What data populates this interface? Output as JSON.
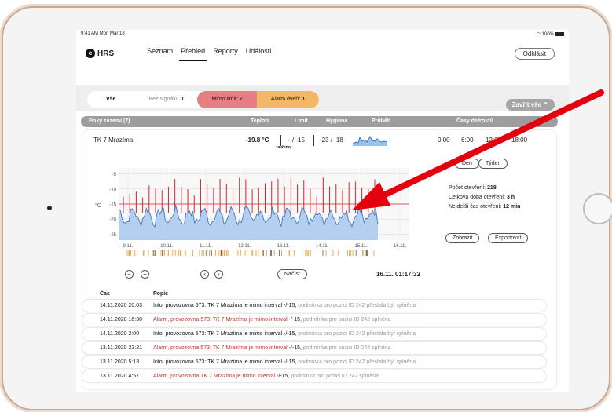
{
  "status": {
    "time": "9:41 AM  Mon Mar 18",
    "battery": "100%"
  },
  "nav": {
    "logo": "HRS",
    "links": [
      "Seznam",
      "Přehled",
      "Reporty",
      "Události"
    ],
    "logout": "Odhlásit"
  },
  "filters": {
    "all": "Vše",
    "nosignal": "Bez signálu: ",
    "nosignal_count": "0",
    "outlimit": "Mimo limit: ",
    "outlimit_count": "7",
    "door": "Alarm dveří: ",
    "door_count": "1",
    "collapse": "Zavřít vše"
  },
  "group": {
    "title": "Boxy zázemí (7)",
    "cols": [
      "Teplota",
      "Limit",
      "Hygiena",
      "Průběh",
      "Časy defrostů"
    ]
  },
  "card": {
    "name": "TK 7 Mrazíma",
    "temp": "-19.8 °C",
    "temp_sub": "zavřeno",
    "limit": "- / -15",
    "hygiene": "-23 / -18",
    "defrost_times": [
      "0:00",
      "6:00",
      "12:00",
      "18:00"
    ],
    "btn_day": "Den",
    "btn_week": "Týden",
    "stat1_label": "Počet otevření: ",
    "stat1_value": "218",
    "stat2_label": "Celková doba otevření: ",
    "stat2_value": "3 h",
    "stat3_label": "Nejdelší čas otevření: ",
    "stat3_value": "12 min",
    "btn_show": "Zobrazit",
    "btn_export": "Exportovat",
    "btn_load": "Načíst",
    "timestamp": "16.11. 01:17:32"
  },
  "chart_data": {
    "type": "line",
    "ylabel": "°C",
    "yticks": [
      "-5",
      "-10",
      "-15",
      "-20",
      "-25"
    ],
    "ylim": [
      -27,
      -3
    ],
    "x": [
      "9.11.",
      "10.11.",
      "11.11.",
      "12.11.",
      "13.11.",
      "14.11.",
      "15.11.",
      "16.11."
    ],
    "limit_line": -15,
    "series": [
      {
        "name": "",
        "color": "#3b78c4"
      }
    ],
    "peaks_color": "#d9232a"
  },
  "log": {
    "col_time": "Čas",
    "col_desc": "Popis",
    "rows": [
      {
        "time": "14.11.2020 20:03",
        "msg": "Info, provozovna  573: TK 7 Mrazíma je mimo interval",
        "mid": " -/-15,",
        "tail": " podmínka pro pozici ID 242 přestala být splněna",
        "type": "normal"
      },
      {
        "time": "14.11.2020 16:30",
        "msg": "Alarm, provozovna  573: TK 7 Mrazíma je mimo interval",
        "mid": " -/-15,",
        "tail": " podmínka pro pozici ID 242 splněna",
        "type": "alarm"
      },
      {
        "time": "14.11.2020 2:00",
        "msg": "Info, provozovna  573: TK 7 Mrazíma je mimo interval",
        "mid": " -/-15,",
        "tail": " podmínka pro pozici ID 242 přestala být splněna",
        "type": "normal"
      },
      {
        "time": "13.11.2020 23:21",
        "msg": "Alarm, provozovna  573: TK 7 Mrazíma je mimo interval",
        "mid": " -/-15,",
        "tail": " podmínka pro pozici ID 242 splněna",
        "type": "alarm"
      },
      {
        "time": "13.11.2020 5:13",
        "msg": "Info, provozovna  573: TK 7 Mrazíma je mimo interval",
        "mid": " -/-15,",
        "tail": " podmínka pro pozici ID 242 přestala být splněna",
        "type": "normal"
      },
      {
        "time": "13.11.2020 4:57",
        "msg": "Alarm, provozovna TK 7 Mrazíma je mimo interval",
        "mid": " -/-15,",
        "tail": " podmínka pro pozici ID 242 splněna",
        "type": "alarm"
      }
    ]
  }
}
